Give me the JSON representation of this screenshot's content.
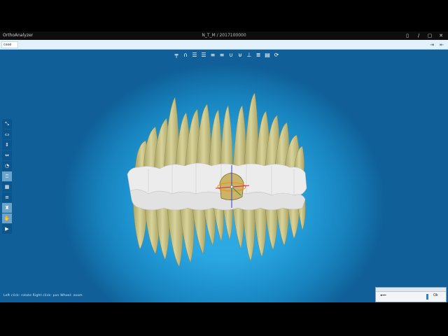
{
  "app": {
    "name": "OrthoAnalyzer",
    "document_title": "N_T_M / 2017100000"
  },
  "window_controls": [
    "▯",
    "∕",
    "▢",
    "✕"
  ],
  "tab": {
    "label": "case"
  },
  "tab_tools": [
    "⇥",
    "⇤"
  ],
  "top_toolbar": [
    {
      "icon": "arch-view-icon",
      "glyph": "╤"
    },
    {
      "icon": "upper-arch-icon",
      "glyph": "∩"
    },
    {
      "icon": "grid-left-icon",
      "glyph": "☰"
    },
    {
      "icon": "grid-right-icon",
      "glyph": "☰"
    },
    {
      "icon": "lower-left-icon",
      "glyph": "≡"
    },
    {
      "icon": "lower-right-icon",
      "glyph": "≡"
    },
    {
      "icon": "lower-arch-icon",
      "glyph": "∪"
    },
    {
      "icon": "occlusion-icon",
      "glyph": "⊎"
    },
    {
      "icon": "split-icon",
      "glyph": "⊥"
    },
    {
      "icon": "stack-icon",
      "glyph": "≣"
    },
    {
      "icon": "layers-icon",
      "glyph": "▤"
    },
    {
      "icon": "reset-view-icon",
      "glyph": "⟳"
    }
  ],
  "left_toolbar": [
    {
      "icon": "fit-view-icon",
      "glyph": "⤡",
      "active": false
    },
    {
      "icon": "ruler-icon",
      "glyph": "▭",
      "active": false
    },
    {
      "icon": "expand-vertical-icon",
      "glyph": "⇕",
      "active": false
    },
    {
      "icon": "expand-horizontal-icon",
      "glyph": "⇔",
      "active": false
    },
    {
      "icon": "tooth-color-icon",
      "glyph": "◔",
      "active": false
    },
    {
      "icon": "tooth-icon",
      "glyph": "♖",
      "active": true
    },
    {
      "icon": "grid-icon",
      "glyph": "▦",
      "active": false
    },
    {
      "icon": "lines-icon",
      "glyph": "≡",
      "active": false
    },
    {
      "icon": "attachment-icon",
      "glyph": "♜",
      "active": true
    },
    {
      "icon": "select-tooth-icon",
      "glyph": "✋",
      "active": true
    },
    {
      "icon": "play-icon",
      "glyph": "▶",
      "active": false
    }
  ],
  "status_bar": {
    "text": "Left click: rotate  Right click: pan  Wheel: zoom"
  },
  "mini_panel": {
    "label": "◂╼━",
    "button": "Ok"
  },
  "colors": {
    "tooth": "#cec88b",
    "tooth_shadow": "#a9a364",
    "gingiva_band": "#ececec",
    "viewport_center": "#33b0e8",
    "viewport_edge": "#105f98"
  }
}
